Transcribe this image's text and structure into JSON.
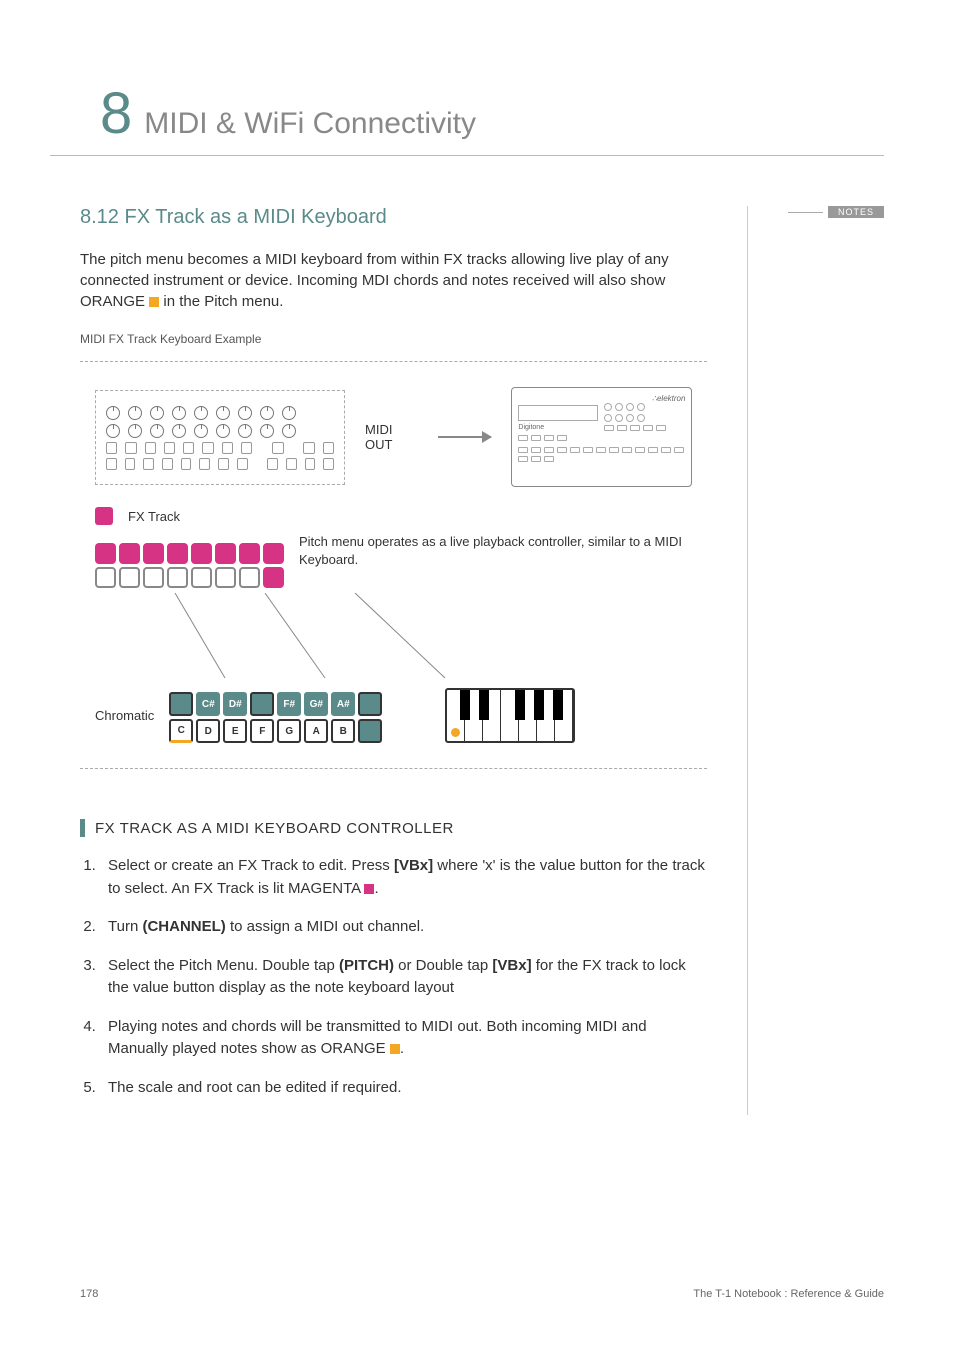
{
  "chapter": {
    "number": "8",
    "title": "MIDI & WiFi Connectivity"
  },
  "section": {
    "number_title": "8.12 FX Track as a MIDI Keyboard"
  },
  "intro_p1": "The pitch menu becomes a MIDI keyboard from within FX tracks allowing live play of any connected instrument or device. Incoming MDI chords and notes received will also show ORANGE ",
  "intro_p2": " in the Pitch menu.",
  "notes_label": "NOTES",
  "diagram": {
    "caption": "MIDI FX Track Keyboard Example",
    "midi_out": "MIDI OUT",
    "fx_track_label": "FX Track",
    "pitch_desc": "Pitch menu operates as a live playback controller, similar to a MIDI Keyboard.",
    "chromatic_label": "Chromatic",
    "black_keys": [
      "",
      "C#",
      "D#",
      "",
      "F#",
      "G#",
      "A#",
      ""
    ],
    "white_keys": [
      "C",
      "D",
      "E",
      "F",
      "G",
      "A",
      "B",
      ""
    ],
    "target_brand": "∴elektron",
    "target_name": "Digitone"
  },
  "subsection": {
    "title": "FX TRACK AS A MIDI KEYBOARD CONTROLLER"
  },
  "steps": {
    "s1a": "Select or create an FX Track to edit. Press ",
    "s1b": "[VBx]",
    "s1c": " where 'x' is the value button for the track to select. An FX Track is lit MAGENTA ",
    "s1d": ".",
    "s2a": "Turn ",
    "s2b": "(CHANNEL)",
    "s2c": " to assign a MIDI out channel.",
    "s3a": "Select the Pitch Menu. Double tap ",
    "s3b": "(PITCH)",
    "s3c": " or Double tap ",
    "s3d": "[VBx]",
    "s3e": " for the FX track to lock the value button display as the note keyboard layout",
    "s4a": "Playing notes and chords will be transmitted to MIDI out. Both incoming MIDI and Manually played notes show as ORANGE ",
    "s4b": ".",
    "s5": "The scale and root can be edited if required."
  },
  "footer": {
    "page": "178",
    "ref": "The T-1 Notebook : Reference & Guide"
  }
}
